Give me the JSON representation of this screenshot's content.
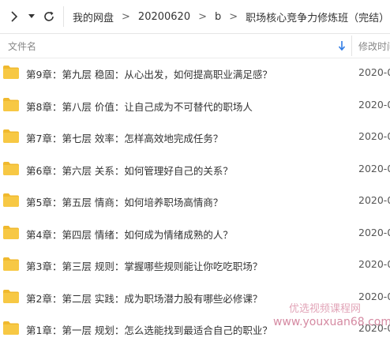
{
  "toolbar": {
    "nav_forward_icon": "chevron-right-icon",
    "dropdown_icon": "caret-down-icon",
    "refresh_icon": "refresh-icon"
  },
  "breadcrumb": {
    "items": [
      "我的网盘",
      "20200620",
      "b",
      "职场核心竞争力修炼班（完结）"
    ],
    "separator": ">"
  },
  "columns": {
    "name": "文件名",
    "modified": "修改时间",
    "sort_icon": "arrow-down-icon"
  },
  "files": [
    {
      "name": "第9章：第九层 稳固：从心出发，如何提高职业满足感？",
      "date": "2020-0"
    },
    {
      "name": "第8章：第八层 价值：让自己成为不可替代的职场人",
      "date": "2020-0"
    },
    {
      "name": "第7章：第七层 效率：怎样高效地完成任务？",
      "date": "2020-0"
    },
    {
      "name": "第6章：第六层 关系：如何管理好自己的关系？",
      "date": "2020-0"
    },
    {
      "name": "第5章：第五层 情商：如何培养职场高情商？",
      "date": "2020-0"
    },
    {
      "name": "第4章：第四层 情绪：如何成为情绪成熟的人？",
      "date": "2020-0"
    },
    {
      "name": "第3章：第三层 规则：掌握哪些规则能让你吃吃职场？",
      "date": "2020-0"
    },
    {
      "name": "第2章：第二层 实践：成为职场潜力股有哪些必修课？",
      "date": "2020-0"
    },
    {
      "name": "第1章：第一层 规划：怎么选能找到最适合自己的职业？",
      "date": "2020-0"
    }
  ],
  "watermark": {
    "line1": "优选视频课程网",
    "line2": "www.youxuan68.com"
  },
  "colors": {
    "folder": "#f7c844",
    "folder_tab": "#f0b92e",
    "accent": "#2f7be5",
    "watermark": "#d58aa2"
  }
}
